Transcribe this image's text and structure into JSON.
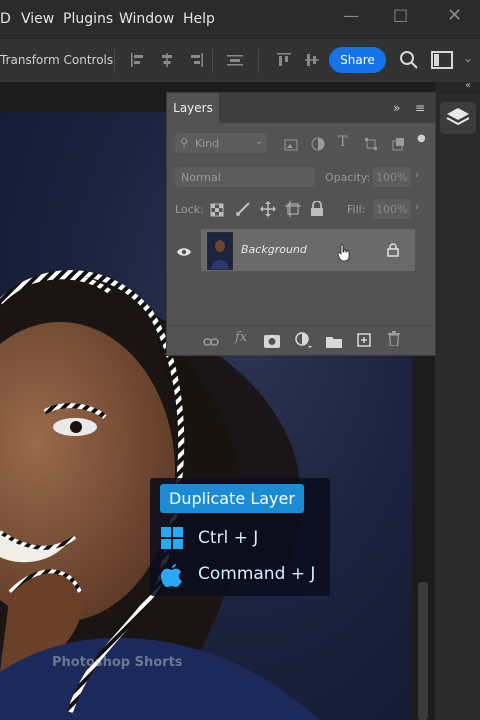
{
  "menu": {
    "partial_item": "D",
    "items": [
      "View",
      "Plugins",
      "Window",
      "Help"
    ]
  },
  "options_bar": {
    "tool_option": "Transform Controls",
    "share_label": "Share",
    "share_color": "#1473e6"
  },
  "layers_panel": {
    "tab_label": "Layers",
    "filter_kind": "Kind",
    "blend_mode": "Normal",
    "opacity_label": "Opacity:",
    "opacity_value": "100%",
    "lock_label": "Lock:",
    "fill_label": "Fill:",
    "fill_value": "100%",
    "layer_name": "Background"
  },
  "shortcut_card": {
    "title": "Duplicate Layer",
    "windows_shortcut": "Ctrl + J",
    "mac_shortcut": "Command + J",
    "accent": "#1b8bd4"
  },
  "watermark": "Photoshop Shorts"
}
